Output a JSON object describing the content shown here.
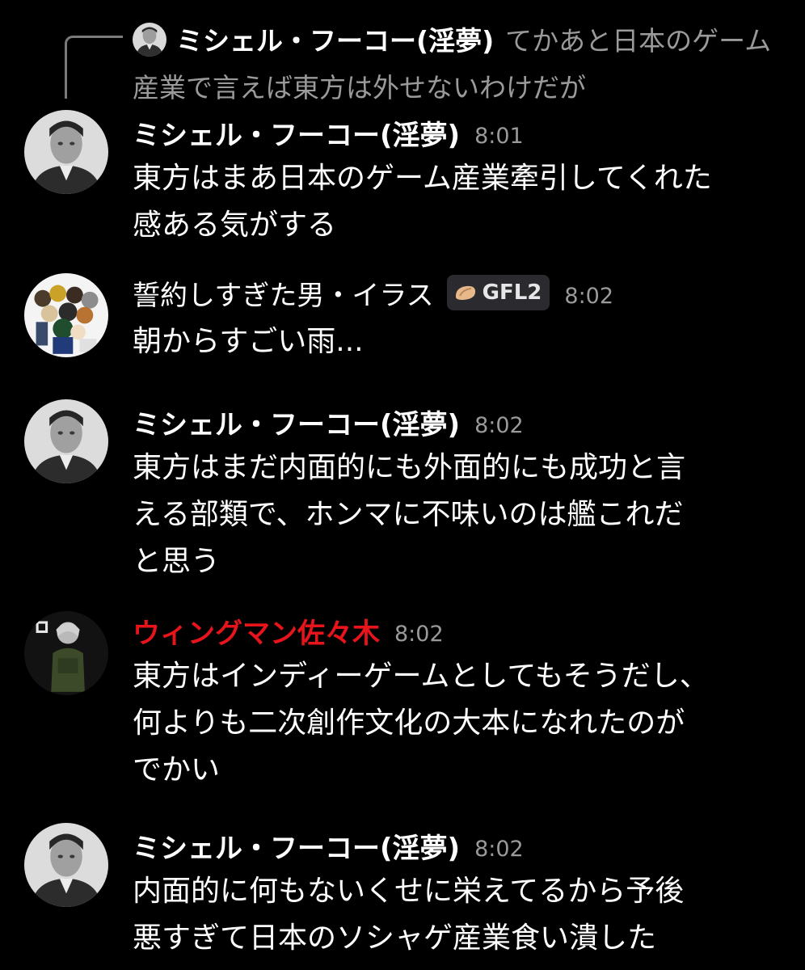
{
  "reply_preview": {
    "author": "ミシェル・フーコー(淫夢)",
    "text": "てかあと日本のゲーム産業で言えば東方は外せないわけだが",
    "avatar_icon": "portrait-avatar-icon"
  },
  "messages": [
    {
      "author": "ミシェル・フーコー(淫夢)",
      "time": "8:01",
      "lines": [
        "東方はまあ日本のゲーム産業牽引してくれた",
        "感ある気がする"
      ],
      "avatar_icon": "portrait-avatar-icon"
    },
    {
      "author": "誓約しすぎた男・イラス",
      "time": "8:02",
      "tag": "GFL2",
      "tag_icon": "dumpling-icon",
      "lines": [
        "朝からすごい雨..."
      ],
      "avatar_icon": "anime-group-avatar-icon"
    },
    {
      "author": "ミシェル・フーコー(淫夢)",
      "time": "8:02",
      "lines": [
        "東方はまだ内面的にも外面的にも成功と言",
        "える部類で、ホンマに不味いのは艦これだ",
        "と思う"
      ],
      "avatar_icon": "portrait-avatar-icon"
    },
    {
      "author": "ウィングマン佐々木",
      "author_color": "#e8141c",
      "time": "8:02",
      "lines": [
        "東方はインディーゲームとしてもそうだし、",
        "何よりも二次創作文化の大本になれたのが",
        "でかい"
      ],
      "avatar_icon": "soldier-avatar-icon"
    },
    {
      "author": "ミシェル・フーコー(淫夢)",
      "time": "8:02",
      "lines": [
        "内面的に何もないくせに栄えてるから予後",
        "悪すぎて日本のソシャゲ産業食い潰した"
      ],
      "avatar_icon": "portrait-avatar-icon"
    }
  ]
}
